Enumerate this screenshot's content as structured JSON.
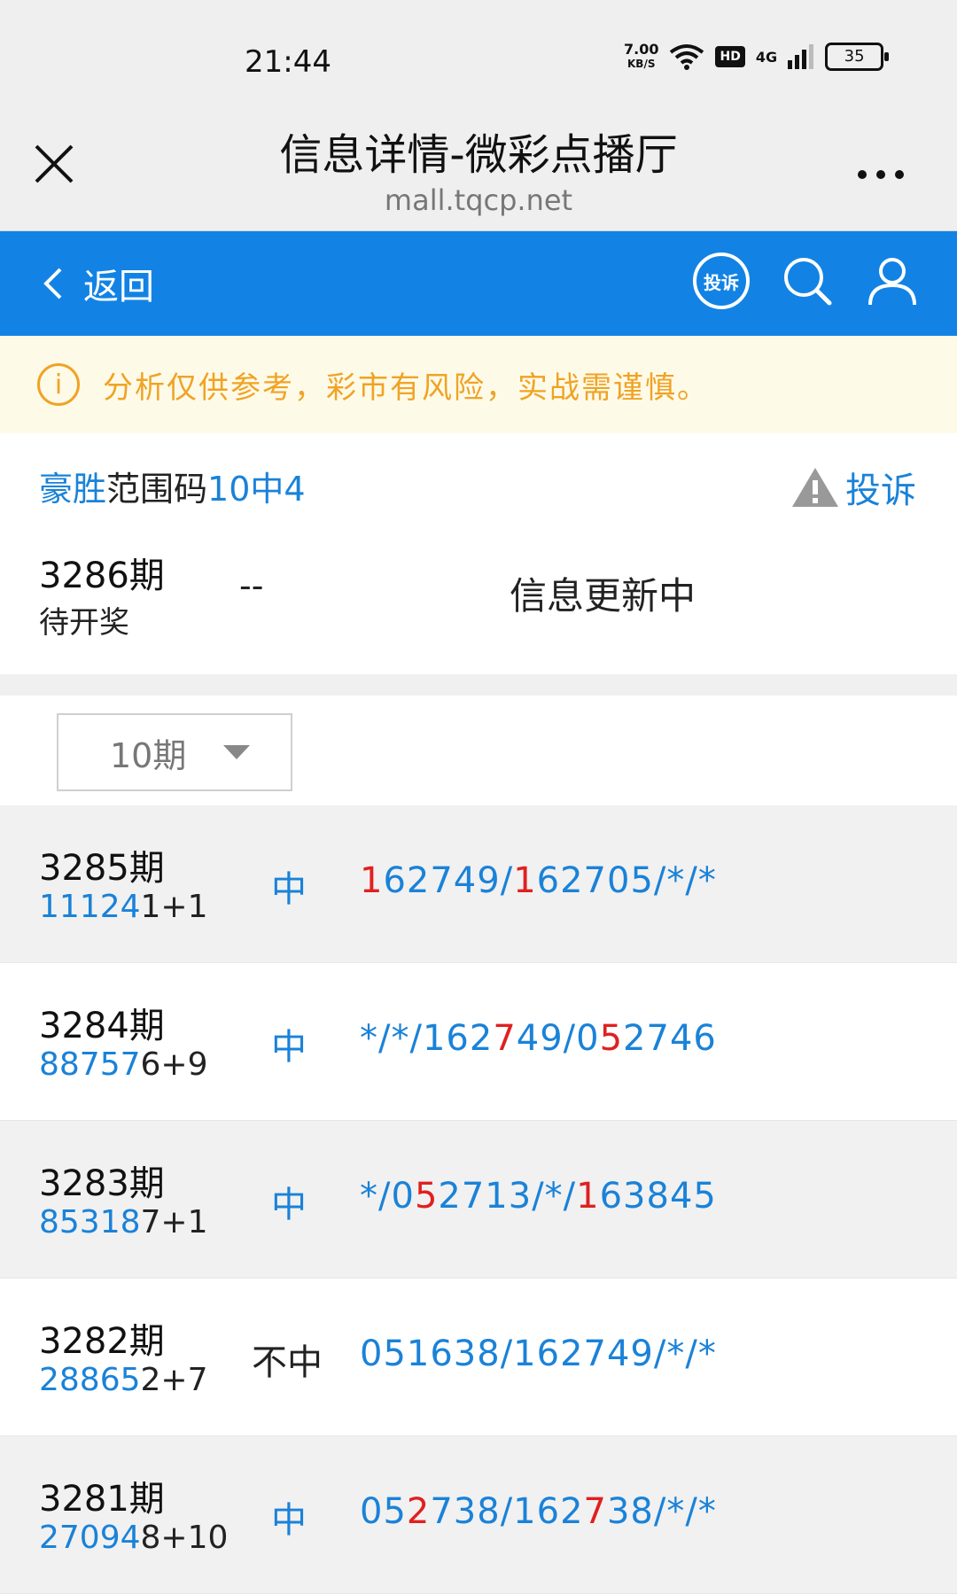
{
  "status_bar": {
    "time": "21:44",
    "net_speed": "7.00",
    "net_unit": "KB/S",
    "hd": "HD",
    "signal": "4G",
    "battery": "35"
  },
  "title_bar": {
    "title": "信息详情-微彩点播厅",
    "url": "mall.tqcp.net",
    "close_icon": "close-icon",
    "more_icon": "more-icon"
  },
  "nav": {
    "back_label": "返回",
    "complain_label": "投诉",
    "search_icon": "search-icon",
    "user_icon": "user-icon",
    "accent": "#1283e5"
  },
  "notice": {
    "text": "分析仅供参考，彩市有风险，实战需谨慎。",
    "color": "#f0a324"
  },
  "header": {
    "name_part1": "豪胜",
    "name_part2": "范围码",
    "name_part3": "10中4",
    "complain_label": "投诉",
    "current_issue": "3286期",
    "current_status": "待开奖",
    "current_dash": "--",
    "current_update": "信息更新中"
  },
  "filter": {
    "period_label": "10期"
  },
  "rows": [
    {
      "issue": "3285期",
      "draw_hl": "11124",
      "draw_rest": "1+1",
      "result": "中",
      "hit": true,
      "codes": [
        {
          "t": "1",
          "r": true
        },
        {
          "t": "62749/",
          "r": false
        },
        {
          "t": "1",
          "r": true
        },
        {
          "t": "62705/*/*",
          "r": false
        }
      ]
    },
    {
      "issue": "3284期",
      "draw_hl": "88757",
      "draw_rest": "6+9",
      "result": "中",
      "hit": true,
      "codes": [
        {
          "t": "*/*/162",
          "r": false
        },
        {
          "t": "7",
          "r": true
        },
        {
          "t": "49/0",
          "r": false
        },
        {
          "t": "5",
          "r": true
        },
        {
          "t": "2746",
          "r": false
        }
      ]
    },
    {
      "issue": "3283期",
      "draw_hl": "85318",
      "draw_rest": "7+1",
      "result": "中",
      "hit": true,
      "codes": [
        {
          "t": "*/0",
          "r": false
        },
        {
          "t": "5",
          "r": true
        },
        {
          "t": "2713/*/",
          "r": false
        },
        {
          "t": "1",
          "r": true
        },
        {
          "t": "63845",
          "r": false
        }
      ]
    },
    {
      "issue": "3282期",
      "draw_hl": "28865",
      "draw_rest": "2+7",
      "result": "不中",
      "hit": false,
      "codes": [
        {
          "t": "051638/162749/*/*",
          "r": false
        }
      ]
    },
    {
      "issue": "3281期",
      "draw_hl": "27094",
      "draw_rest": "8+10",
      "result": "中",
      "hit": true,
      "codes": [
        {
          "t": "05",
          "r": false
        },
        {
          "t": "2",
          "r": true
        },
        {
          "t": "738/162",
          "r": false
        },
        {
          "t": "7",
          "r": true
        },
        {
          "t": "38/*/*",
          "r": false
        }
      ]
    }
  ]
}
